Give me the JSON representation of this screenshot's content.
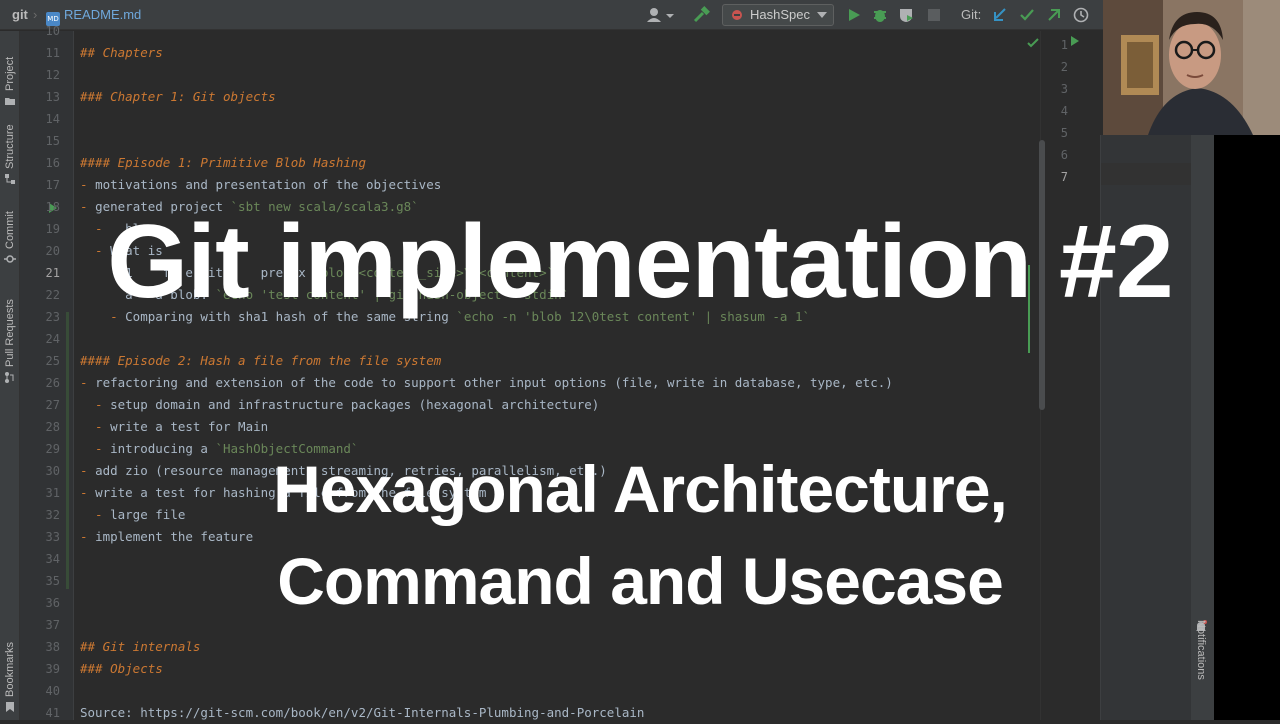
{
  "toolbar": {
    "project": "git",
    "file": "README.md",
    "file_badge": "MD",
    "run_config": "HashSpec",
    "git_label": "Git:"
  },
  "left_tabs": [
    "Project",
    "Structure",
    "Commit",
    "Pull Requests",
    "Bookmarks"
  ],
  "right_tabs": [
    "Notifications"
  ],
  "editor": {
    "lines": [
      {
        "n": "10",
        "parts": []
      },
      {
        "n": "11",
        "parts": [
          {
            "t": "## ",
            "c": "heading"
          },
          {
            "t": "Chapters",
            "c": "htext"
          }
        ]
      },
      {
        "n": "12",
        "parts": []
      },
      {
        "n": "13",
        "parts": [
          {
            "t": "### ",
            "c": "heading"
          },
          {
            "t": "Chapter 1: Git objects",
            "c": "htext"
          }
        ]
      },
      {
        "n": "14",
        "parts": []
      },
      {
        "n": "15",
        "parts": []
      },
      {
        "n": "16",
        "parts": [
          {
            "t": "#### ",
            "c": "heading"
          },
          {
            "t": "Episode 1: Primitive Blob Hashing",
            "c": "htext"
          }
        ]
      },
      {
        "n": "17",
        "parts": [
          {
            "t": "- ",
            "c": "bullet"
          },
          {
            "t": "motivations and presentation of the objectives",
            "c": "text"
          }
        ]
      },
      {
        "n": "18",
        "parts": [
          {
            "t": "- ",
            "c": "bullet"
          },
          {
            "t": "generated project ",
            "c": "text"
          },
          {
            "t": "`sbt new scala/scala3.g8`",
            "c": "code"
          }
        ]
      },
      {
        "n": "19",
        "parts": [
          {
            "t": "  - ",
            "c": "bullet"
          },
          {
            "t": "  bl",
            "c": "text"
          }
        ]
      },
      {
        "n": "20",
        "parts": [
          {
            "t": "  - ",
            "c": "bullet"
          },
          {
            "t": "What is",
            "c": "text"
          }
        ]
      },
      {
        "n": "21",
        "parts": [
          {
            "t": "      ",
            "c": "text"
          },
          {
            "t": "1",
            "c": "text"
          },
          {
            "t": "    f  e with    prefix ",
            "c": "text"
          },
          {
            "t": "`blob <content_size>\\0<content>`",
            "c": "code"
          }
        ]
      },
      {
        "n": "22",
        "parts": [
          {
            "t": "      ",
            "c": "text"
          },
          {
            "t": "a   a blob: ",
            "c": "text"
          },
          {
            "t": "`echo 'test content' | git hash-object --stdin`",
            "c": "code"
          }
        ]
      },
      {
        "n": "23",
        "parts": [
          {
            "t": "    - ",
            "c": "bullet"
          },
          {
            "t": "Comparing with sha1 hash of the same string ",
            "c": "text"
          },
          {
            "t": "`echo -n 'blob 12\\0test content' | shasum -a 1`",
            "c": "code"
          }
        ]
      },
      {
        "n": "24",
        "parts": []
      },
      {
        "n": "25",
        "parts": [
          {
            "t": "#### ",
            "c": "heading"
          },
          {
            "t": "Episode 2: Hash a file from the file system",
            "c": "htext"
          }
        ]
      },
      {
        "n": "26",
        "parts": [
          {
            "t": "- ",
            "c": "bullet"
          },
          {
            "t": "refactoring and extension of the code to support other input options (file, write in database, type, etc.)",
            "c": "text"
          }
        ]
      },
      {
        "n": "27",
        "parts": [
          {
            "t": "  - ",
            "c": "bullet"
          },
          {
            "t": "setup domain and infrastructure packages (hexagonal architecture)",
            "c": "text"
          }
        ]
      },
      {
        "n": "28",
        "parts": [
          {
            "t": "  - ",
            "c": "bullet"
          },
          {
            "t": "write a test for Main",
            "c": "text"
          }
        ]
      },
      {
        "n": "29",
        "parts": [
          {
            "t": "  - ",
            "c": "bullet"
          },
          {
            "t": "introducing a ",
            "c": "text"
          },
          {
            "t": "`HashObjectCommand`",
            "c": "code"
          }
        ]
      },
      {
        "n": "30",
        "parts": [
          {
            "t": "- ",
            "c": "bullet"
          },
          {
            "t": "add zio (resource management, streaming, retries, parallelism, etc.)",
            "c": "text"
          }
        ]
      },
      {
        "n": "31",
        "parts": [
          {
            "t": "- ",
            "c": "bullet"
          },
          {
            "t": "write a test for hashing a file from the file system",
            "c": "text"
          }
        ]
      },
      {
        "n": "32",
        "parts": [
          {
            "t": "  - ",
            "c": "bullet"
          },
          {
            "t": "large file",
            "c": "text"
          }
        ]
      },
      {
        "n": "33",
        "parts": [
          {
            "t": "- ",
            "c": "bullet"
          },
          {
            "t": "implement the feature",
            "c": "text"
          }
        ]
      },
      {
        "n": "34",
        "parts": []
      },
      {
        "n": "35",
        "parts": []
      },
      {
        "n": "36",
        "parts": []
      },
      {
        "n": "37",
        "parts": []
      },
      {
        "n": "38",
        "parts": [
          {
            "t": "## ",
            "c": "heading"
          },
          {
            "t": "Git internals",
            "c": "htext"
          }
        ]
      },
      {
        "n": "39",
        "parts": [
          {
            "t": "### ",
            "c": "heading"
          },
          {
            "t": "Objects",
            "c": "htext"
          }
        ]
      },
      {
        "n": "40",
        "parts": []
      },
      {
        "n": "41",
        "parts": [
          {
            "t": "Source: https://git-scm.com/book/en/v2/Git-Internals-Plumbing-and-Porcelain",
            "c": "text"
          }
        ]
      }
    ],
    "active_line": "21"
  },
  "preview_lines": [
    "1",
    "2",
    "3",
    "4",
    "5",
    "6",
    "7"
  ],
  "overlay": {
    "title": "Git implementation #2",
    "subtitle_line1": "Hexagonal Architecture,",
    "subtitle_line2": "Command and Usecase"
  },
  "colors": {
    "editor_bg": "#2b2b2b",
    "heading": "#cc7832",
    "code_span": "#6a8759",
    "text": "#a9b7c6",
    "accent_green": "#499c54"
  }
}
